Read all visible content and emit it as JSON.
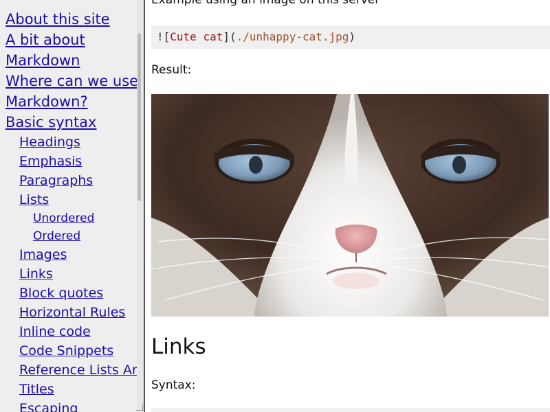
{
  "sidebar": {
    "items": [
      {
        "label": "About this site",
        "level": 1
      },
      {
        "label": "A bit about",
        "level": 1
      },
      {
        "label": "Markdown",
        "level": 1
      },
      {
        "label": "Where can we use",
        "level": 1
      },
      {
        "label": "Markdown?",
        "level": 1
      },
      {
        "label": "Basic syntax",
        "level": 1
      },
      {
        "label": "Headings",
        "level": 2
      },
      {
        "label": "Emphasis",
        "level": 2
      },
      {
        "label": "Paragraphs",
        "level": 2
      },
      {
        "label": "Lists",
        "level": 2
      },
      {
        "label": "Unordered",
        "level": 3
      },
      {
        "label": "Ordered",
        "level": 3
      },
      {
        "label": "Images",
        "level": 2
      },
      {
        "label": "Links",
        "level": 2
      },
      {
        "label": "Block quotes",
        "level": 2
      },
      {
        "label": "Horizontal Rules",
        "level": 2
      },
      {
        "label": "Inline code",
        "level": 2
      },
      {
        "label": "Code Snippets",
        "level": 2
      },
      {
        "label": "Reference Lists And",
        "level": 2
      },
      {
        "label": "Titles",
        "level": 2
      },
      {
        "label": "Escaping",
        "level": 2
      }
    ]
  },
  "main": {
    "clipped_text": "Example using an image on this server",
    "code": {
      "bang": "!",
      "open_bracket": "[",
      "alt": "Cute cat",
      "close_bracket": "]",
      "open_paren": "(",
      "url": "./unhappy-cat.jpg",
      "close_paren": ")"
    },
    "result_label": "Result:",
    "image_subject": "grumpy cat face",
    "links_heading": "Links",
    "syntax_label": "Syntax:"
  },
  "colors": {
    "link": "#1a0dab",
    "sidebar_bg": "#eeeeee",
    "code_bg": "#f0f0f0",
    "code_alt": "#a31515",
    "code_url": "#a0522d"
  }
}
